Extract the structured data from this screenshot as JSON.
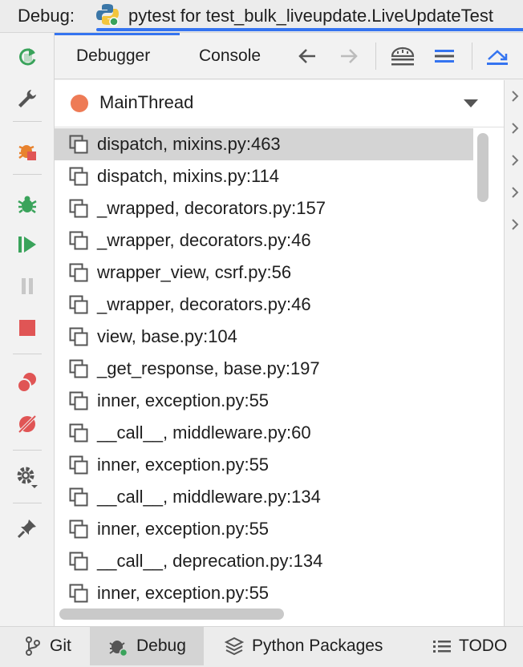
{
  "titlebar": {
    "label": "Debug:",
    "run_tab": "pytest for test_bulk_liveupdate.LiveUpdateTest"
  },
  "tabs": [
    {
      "label": "Debugger",
      "selected": true
    },
    {
      "label": "Console",
      "selected": false
    }
  ],
  "thread": {
    "name": "MainThread",
    "color": "#ee7b56"
  },
  "frames": [
    "dispatch, mixins.py:463",
    "dispatch, mixins.py:114",
    "_wrapped, decorators.py:157",
    "_wrapper, decorators.py:46",
    "wrapper_view, csrf.py:56",
    "_wrapper, decorators.py:46",
    "view, base.py:104",
    "_get_response, base.py:197",
    "inner, exception.py:55",
    "__call__, middleware.py:60",
    "inner, exception.py:55",
    "__call__, middleware.py:134",
    "inner, exception.py:55",
    "__call__, deprecation.py:134",
    "inner, exception.py:55"
  ],
  "bottombar": {
    "git": "Git",
    "debug": "Debug",
    "python_packages": "Python Packages",
    "todo": "TODO"
  },
  "colors": {
    "accent": "#3574f0",
    "green": "#3aa35b",
    "orange": "#e8822e",
    "red": "#e05555"
  }
}
